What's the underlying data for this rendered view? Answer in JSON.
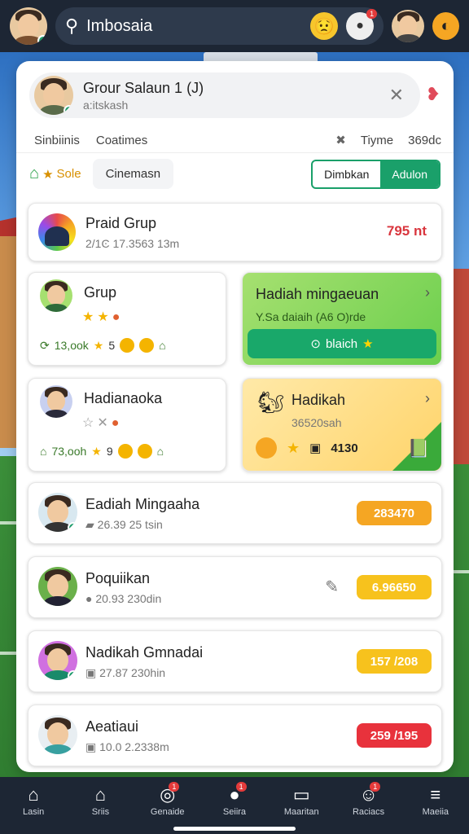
{
  "topbar": {
    "search_value": "Imbosaia",
    "notification_count": "1"
  },
  "group": {
    "title": "Grour Salaun 1 (J)",
    "subtitle": "a:itskash"
  },
  "tabs": {
    "left": [
      "Sinbiinis",
      "Coatimes"
    ],
    "right_time": "Tiyme",
    "right_count": "369dc"
  },
  "filter": {
    "home_label": "Sole",
    "tab": "Cinemasn",
    "seg_left": "Dimbkan",
    "seg_right": "Adulon"
  },
  "prize_group": {
    "title": "Praid Grup",
    "sub": "2/1Ͼ 17.3563 13m",
    "value": "795 nt",
    "value_color": "#d9363e"
  },
  "grid": {
    "grup": {
      "title": "Grup",
      "stat_value": "13,ook",
      "stat_count": "5"
    },
    "weekly": {
      "title": "Hadiah mingaeuan",
      "sub": "Y.Sa daiaih (A6 O)rde",
      "button": "blaich"
    },
    "hadian": {
      "title": "Hadianaoka",
      "stat_value": "73,ooh",
      "stat_count": "9"
    },
    "hadikah": {
      "title": "Hadikah",
      "sub": "36520sah",
      "value": "4130"
    }
  },
  "list": [
    {
      "title": "Eadiah Mingaaha",
      "sub": "26.39 25 tsin",
      "value": "283470",
      "color": "#f5a623"
    },
    {
      "title": "Poquiikan",
      "sub": "20.93 230din",
      "value": "6.96650",
      "color": "#f7c21d"
    },
    {
      "title": "Nadikah Gmnadai",
      "sub": "27.87 230hin",
      "value": "157 /208",
      "color": "#f7c21d"
    },
    {
      "title": "Aeatiaui",
      "sub": "10.0 2.2338m",
      "value": "259 /195",
      "color": "#e8323c"
    }
  ],
  "bottom_nav": [
    {
      "label": "Lasin",
      "icon": "home-icon",
      "glyph": "⌂",
      "badge": ""
    },
    {
      "label": "Sriis",
      "icon": "shop-icon",
      "glyph": "⌂",
      "badge": ""
    },
    {
      "label": "Genaide",
      "icon": "target-icon",
      "glyph": "◎",
      "badge": "1"
    },
    {
      "label": "Seiira",
      "icon": "chat-icon",
      "glyph": "●",
      "badge": "1"
    },
    {
      "label": "Maaritan",
      "icon": "screen-icon",
      "glyph": "▭",
      "badge": ""
    },
    {
      "label": "Raciacs",
      "icon": "face-icon",
      "glyph": "☺",
      "badge": "1"
    },
    {
      "label": "Maeiia",
      "icon": "menu-icon",
      "glyph": "≡",
      "badge": ""
    }
  ]
}
